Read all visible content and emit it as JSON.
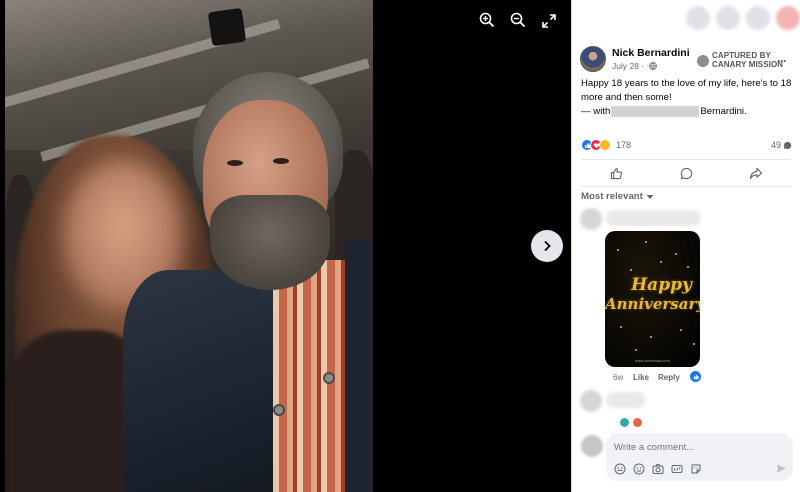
{
  "viewer": {
    "zoom_in_icon": "zoom-in-icon",
    "zoom_out_icon": "zoom-out-icon",
    "fullscreen_icon": "fullscreen-icon",
    "next_icon": "chevron-right-icon"
  },
  "post": {
    "author": "Nick Bernardini",
    "date": "July 28 ·",
    "captured_line1": "CAPTURED BY",
    "captured_line2": "CANARY MISSION",
    "more": "···",
    "text": "Happy 18 years to the love of my life, here's to 18 more and then some!",
    "with_prefix": "— with",
    "with_suffix": "Bernardini.",
    "reaction_count": "178",
    "comment_count": "49",
    "sort_label": "Most relevant"
  },
  "comment": {
    "gif_line1": "Happy",
    "gif_line2": "Anniversary",
    "gif_footer": "www.funimada.com",
    "time": "6w",
    "like": "Like",
    "reply": "Reply"
  },
  "composer": {
    "placeholder": "Write a comment..."
  },
  "colors": {
    "accent": "#1877f2",
    "love": "#f02849",
    "care": "#f7b928",
    "viewer_bg": "#000000"
  }
}
